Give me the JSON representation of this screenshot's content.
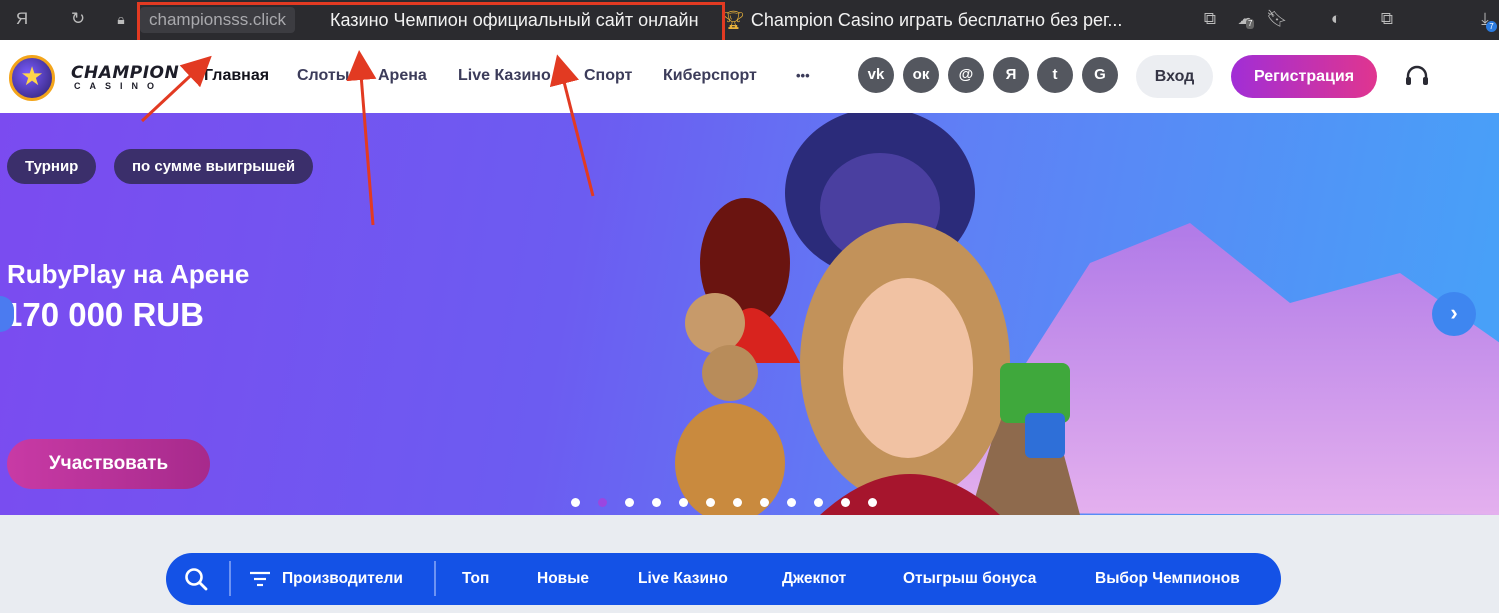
{
  "browser": {
    "url_host": "championsss.click",
    "tab_title": "Казино Чемпион официальный сайт онлайн",
    "tab_title_rest": "Champion Casino играть бесплатно без рег...",
    "extension_badge": "7",
    "download_badge": "7"
  },
  "site": {
    "logo_text": "CHAMPION",
    "logo_subtext": "CASINO",
    "nav": [
      "Главная",
      "Слоты",
      "Арена",
      "Live Казино",
      "Спорт",
      "Киберспорт",
      "•••"
    ],
    "socials": [
      {
        "label": "vk",
        "icon": "vk-icon"
      },
      {
        "label": "ок",
        "icon": "odnoklassniki-icon"
      },
      {
        "label": "@",
        "icon": "mail-icon"
      },
      {
        "label": "Я",
        "icon": "yandex-icon"
      },
      {
        "label": "t",
        "icon": "twitter-icon"
      },
      {
        "label": "G",
        "icon": "google-icon"
      }
    ],
    "login_label": "Вход",
    "register_label": "Регистрация"
  },
  "hero": {
    "chip_1": "Турнир",
    "chip_2": "по сумме выигрышей",
    "title": "RubyPlay на Арене",
    "amount": "170 000 RUB",
    "participate_label": "Участвовать",
    "slides_count": 12,
    "active_slide": 2
  },
  "filters": {
    "providers_label": "Производители",
    "items": [
      "Топ",
      "Новые",
      "Live Казино",
      "Джекпот",
      "Отыгрыш бонуса",
      "Выбор Чемпионов"
    ]
  },
  "colors": {
    "browser_bar": "#2b2b2f",
    "highlight": "#e23a22",
    "register_gradient": [
      "#a12ed6",
      "#e0358f"
    ],
    "filter_bar": "#1452e6",
    "hero_gradient": [
      "#7b4bf0",
      "#46a3f8"
    ]
  }
}
